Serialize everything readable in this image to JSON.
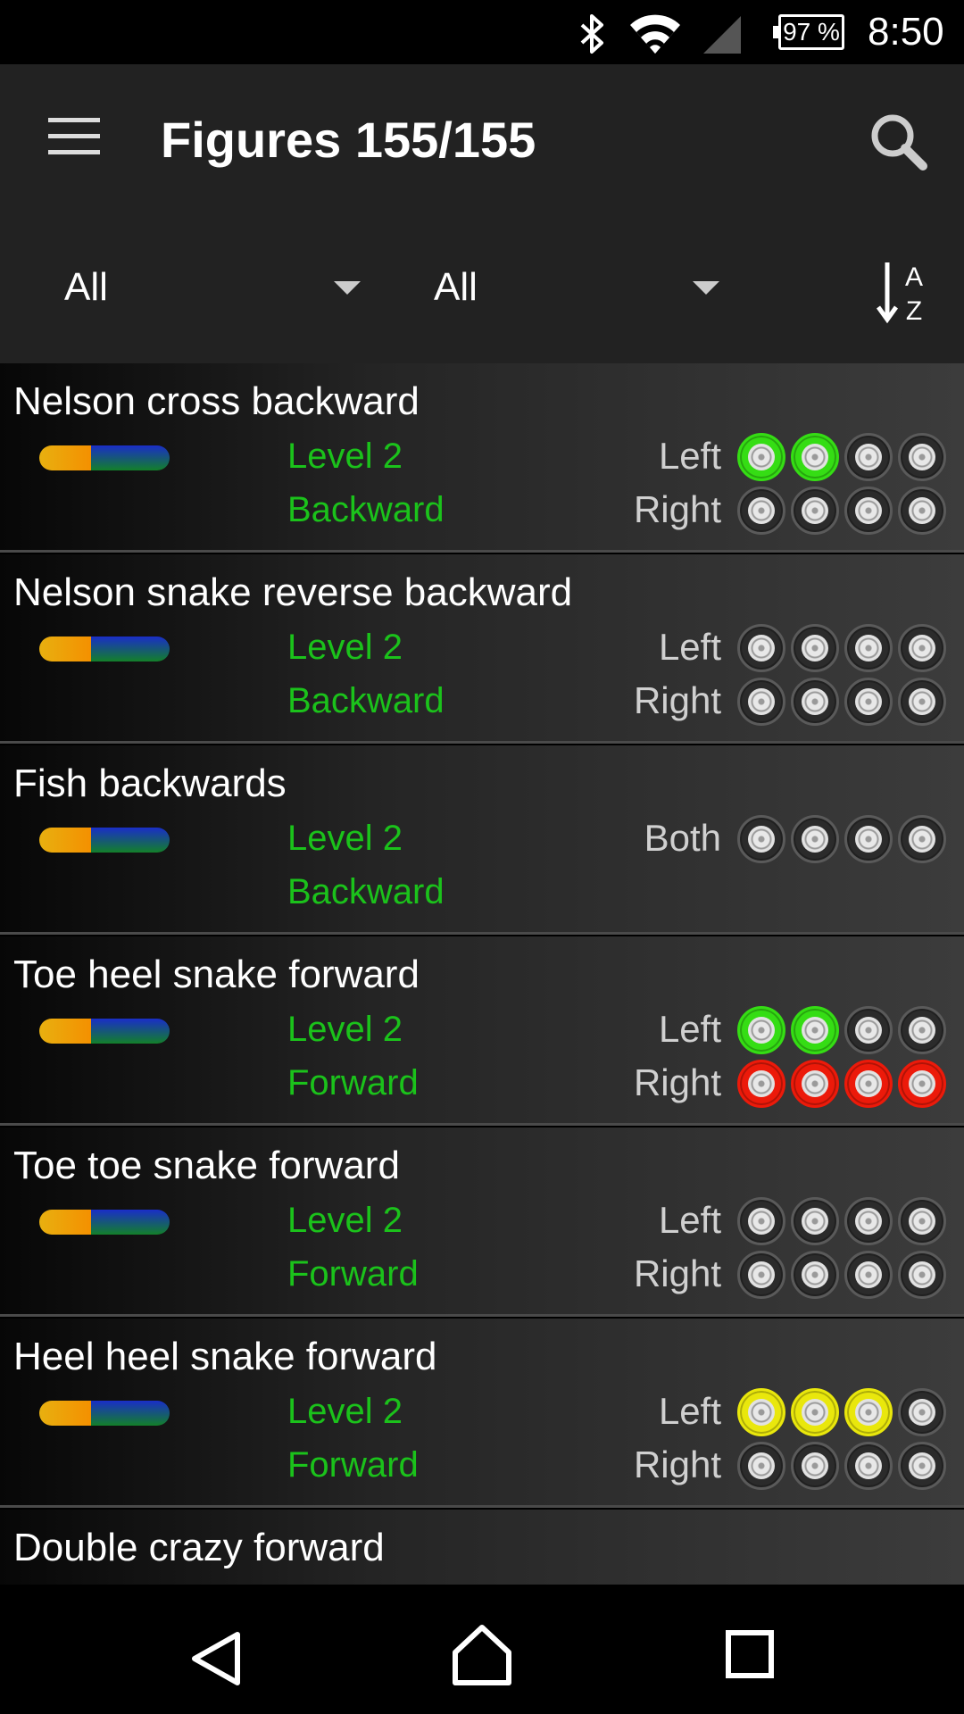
{
  "status_bar": {
    "battery": "97 %",
    "time": "8:50",
    "icons": [
      "bluetooth-icon",
      "wifi-icon",
      "signal-icon",
      "battery-icon"
    ]
  },
  "toolbar": {
    "title": "Figures 155/155",
    "filter_level": "All",
    "filter_direction": "All",
    "sort_top": "A",
    "sort_bottom": "Z"
  },
  "colors": {
    "green": "#35dd14",
    "red": "#ec1a0a",
    "yellow": "#e9e70c",
    "gray": "#2b2b2b",
    "label_green": "#1bc21b"
  },
  "figures": [
    {
      "name": "Nelson cross backward",
      "level": "Level 2",
      "direction": "Backward",
      "rows": [
        {
          "side": "Left",
          "wheels": [
            "green",
            "green",
            "gray",
            "gray"
          ]
        },
        {
          "side": "Right",
          "wheels": [
            "gray",
            "gray",
            "gray",
            "gray"
          ]
        }
      ]
    },
    {
      "name": "Nelson snake reverse backward",
      "level": "Level 2",
      "direction": "Backward",
      "rows": [
        {
          "side": "Left",
          "wheels": [
            "gray",
            "gray",
            "gray",
            "gray"
          ]
        },
        {
          "side": "Right",
          "wheels": [
            "gray",
            "gray",
            "gray",
            "gray"
          ]
        }
      ]
    },
    {
      "name": "Fish backwards",
      "level": "Level 2",
      "direction": "Backward",
      "rows": [
        {
          "side": "Both",
          "wheels": [
            "gray",
            "gray",
            "gray",
            "gray"
          ]
        }
      ]
    },
    {
      "name": "Toe heel snake forward",
      "level": "Level 2",
      "direction": "Forward",
      "rows": [
        {
          "side": "Left",
          "wheels": [
            "green",
            "green",
            "gray",
            "gray"
          ]
        },
        {
          "side": "Right",
          "wheels": [
            "red",
            "red",
            "red",
            "red"
          ]
        }
      ]
    },
    {
      "name": "Toe toe snake forward",
      "level": "Level 2",
      "direction": "Forward",
      "rows": [
        {
          "side": "Left",
          "wheels": [
            "gray",
            "gray",
            "gray",
            "gray"
          ]
        },
        {
          "side": "Right",
          "wheels": [
            "gray",
            "gray",
            "gray",
            "gray"
          ]
        }
      ]
    },
    {
      "name": "Heel heel snake forward",
      "level": "Level 2",
      "direction": "Forward",
      "rows": [
        {
          "side": "Left",
          "wheels": [
            "yellow",
            "yellow",
            "yellow",
            "gray"
          ]
        },
        {
          "side": "Right",
          "wheels": [
            "gray",
            "gray",
            "gray",
            "gray"
          ]
        }
      ]
    },
    {
      "name": "Double crazy forward",
      "level": "",
      "direction": "",
      "rows": []
    }
  ],
  "nav": {
    "icons": [
      "back-icon",
      "home-icon",
      "recents-icon"
    ]
  }
}
